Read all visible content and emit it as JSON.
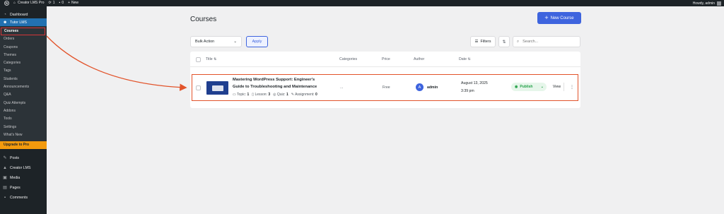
{
  "adminbar": {
    "site_name": "Creator LMS Pro",
    "updates_count": "1",
    "comments_count": "0",
    "new_label": "New",
    "howdy": "Howdy, admin"
  },
  "sidebar": {
    "dashboard": "Dashboard",
    "tutor_lms": "Tutor LMS",
    "submenu": [
      "Courses",
      "Orders",
      "Coupons",
      "Themes",
      "Categories",
      "Tags",
      "Students",
      "Announcements",
      "Q&A",
      "Quiz Attempts",
      "Addons",
      "Tools",
      "Settings",
      "What's New"
    ],
    "upgrade": "Upgrade to Pro",
    "lower": [
      {
        "label": "Posts",
        "icon": "pin-icon"
      },
      {
        "label": "Creator LMS",
        "icon": "graduation-icon"
      },
      {
        "label": "Media",
        "icon": "media-icon"
      },
      {
        "label": "Pages",
        "icon": "pages-icon"
      },
      {
        "label": "Comments",
        "icon": "comment-icon"
      }
    ]
  },
  "main": {
    "title": "Courses",
    "new_course": "New Course",
    "bulk_action": "Bulk Action",
    "apply": "Apply",
    "filters": "Filters",
    "search_placeholder": "Search..."
  },
  "table": {
    "headers": {
      "title": "Title",
      "categories": "Categories",
      "price": "Price",
      "author": "Author",
      "date": "Date"
    },
    "row": {
      "title_line1": "Mastering WordPress Support: Engineer's",
      "title_line2": "Guide to Troubleshooting and Maintenance",
      "topic_label": "Topic:",
      "topic_count": "1",
      "lesson_label": "Lesson:",
      "lesson_count": "3",
      "quiz_label": "Quiz:",
      "quiz_count": "1",
      "assignment_label": "Assignment:",
      "assignment_count": "0",
      "categories": "...",
      "price": "Free",
      "author_initial": "A",
      "author": "admin",
      "date": "August 13, 2025",
      "time": "3:39 pm",
      "status": "Publish",
      "view": "View"
    }
  },
  "colors": {
    "accent": "#3e64de",
    "highlight": "#e2532a",
    "publish": "#24a148",
    "upgrade": "#f39a0d"
  }
}
